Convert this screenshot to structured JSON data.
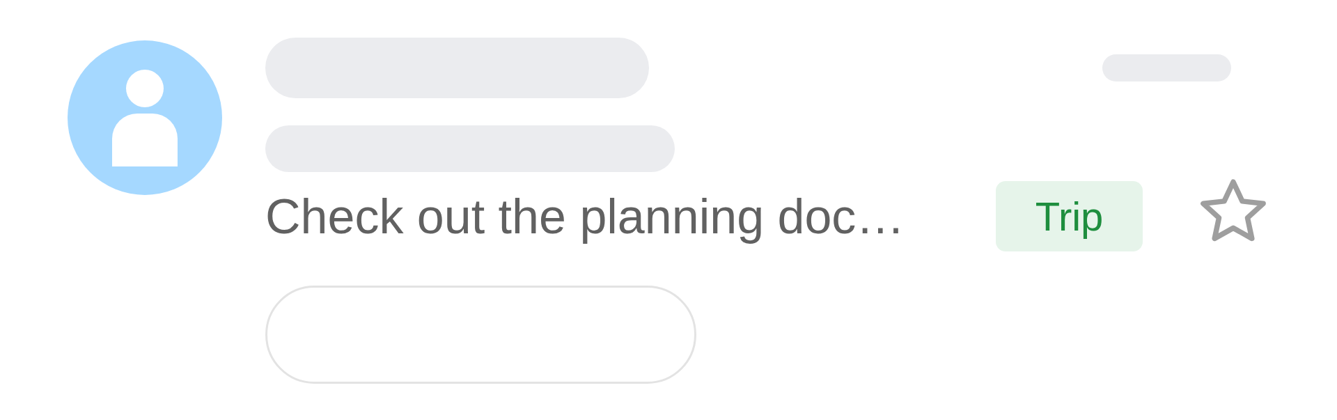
{
  "message": {
    "snippet": "Check out the planning doc…",
    "label": "Trip",
    "starred": false
  }
}
